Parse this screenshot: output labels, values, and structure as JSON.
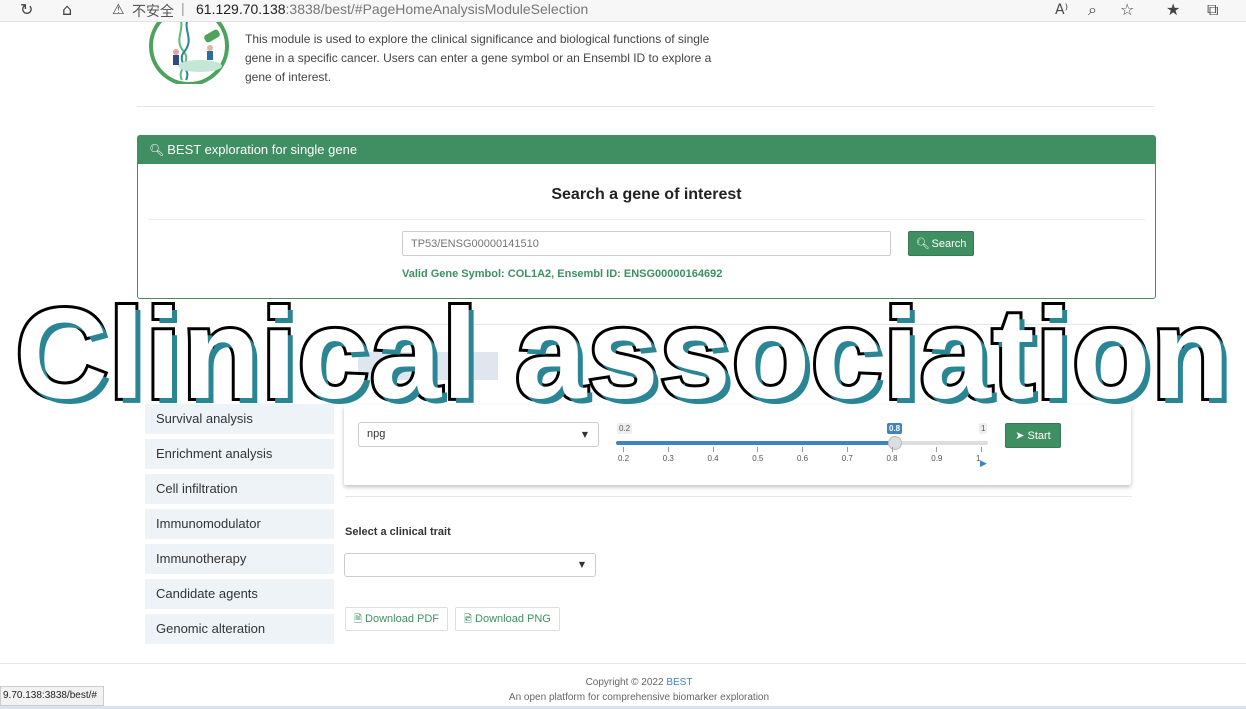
{
  "browser": {
    "insecure_label": "不安全",
    "url_host": "61.129.70.138",
    "url_rest": ":3838/best/#PageHomeAnalysisModuleSelection",
    "icons": [
      "reload-icon",
      "home-icon",
      "warning-icon",
      "read-aloud-icon",
      "zoom-icon",
      "favorite-icon",
      "favorites-icon",
      "collections-icon"
    ]
  },
  "module": {
    "description": "This module is used to explore the clinical significance and biological functions of single gene in a specific cancer. Users can enter a gene symbol or an Ensembl ID to explore a gene of interest."
  },
  "search_panel": {
    "header": "BEST exploration for single gene",
    "title": "Search a gene of interest",
    "input_placeholder": "TP53/ENSG00000141510",
    "search_label": "Search",
    "valid_text": "Valid Gene Symbol: COL1A2, Ensembl ID: ENSG00000164692"
  },
  "sidebar": {
    "items": [
      {
        "label": "Survival analysis"
      },
      {
        "label": "Enrichment analysis"
      },
      {
        "label": "Cell infiltration"
      },
      {
        "label": "Immunomodulator"
      },
      {
        "label": "Immunotherapy"
      },
      {
        "label": "Candidate agents"
      },
      {
        "label": "Genomic alteration"
      }
    ]
  },
  "options": {
    "palette": "npg",
    "slider": {
      "min": 0.2,
      "max": 1,
      "value": 0.8,
      "min_label": "0.2",
      "max_label": "1",
      "value_label": "0.8",
      "ticks": [
        "0.2",
        "0.3",
        "0.4",
        "0.5",
        "0.6",
        "0.7",
        "0.8",
        "0.9",
        "1"
      ]
    },
    "start_label": "Start"
  },
  "trait": {
    "label": "Select a clinical trait",
    "value": ""
  },
  "downloads": {
    "pdf_label": "Download PDF",
    "png_label": "Download PNG"
  },
  "footer": {
    "copyright_prefix": "Copyright © 2022 ",
    "brand": "BEST",
    "tagline": "An open platform for comprehensive biomarker exploration"
  },
  "status_url": "9.70.138:3838/best/#",
  "overlay_title": "Clinical association",
  "colors": {
    "accent_green": "#3f8f63",
    "slider_blue": "#3e83c4",
    "caption_shadow": "#2a8595"
  }
}
